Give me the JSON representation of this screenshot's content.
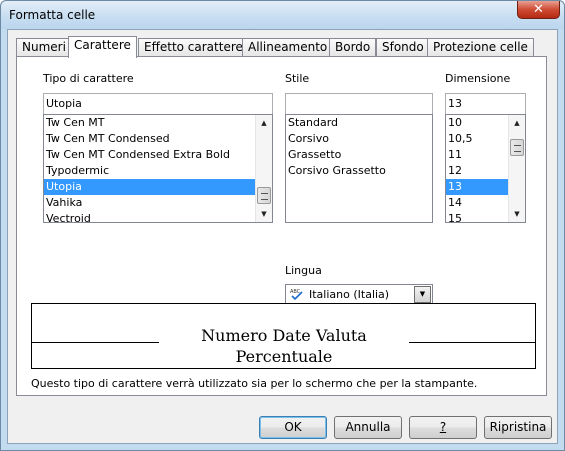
{
  "window": {
    "title": "Formatta celle",
    "close_glyph": "✕"
  },
  "tabs": [
    {
      "label": "Numeri",
      "active": false
    },
    {
      "label": "Carattere",
      "active": true
    },
    {
      "label": "Effetto carattere",
      "active": false
    },
    {
      "label": "Allineamento",
      "active": false
    },
    {
      "label": "Bordo",
      "active": false
    },
    {
      "label": "Sfondo",
      "active": false
    },
    {
      "label": "Protezione celle",
      "active": false
    }
  ],
  "font": {
    "label": "Tipo di carattere",
    "value": "Utopia",
    "items": [
      "Tw Cen MT",
      "Tw Cen MT Condensed",
      "Tw Cen MT Condensed Extra Bold",
      "Typodermic",
      "Utopia",
      "Vahika",
      "Vectroid"
    ],
    "selected": "Utopia"
  },
  "style": {
    "label": "Stile",
    "value": "",
    "items": [
      "Standard",
      "Corsivo",
      "Grassetto",
      "Corsivo Grassetto"
    ]
  },
  "size": {
    "label": "Dimensione",
    "value": "13",
    "items": [
      "10",
      "10,5",
      "11",
      "12",
      "13",
      "14",
      "15"
    ],
    "selected": "13"
  },
  "language": {
    "label": "Lingua",
    "value": "Italiano (Italia)",
    "icon": "spellcheck-icon"
  },
  "preview": {
    "text": "Numero Date Valuta Percentuale"
  },
  "info": {
    "text": "Questo tipo di carattere verrà utilizzato sia per lo schermo che per la stampante."
  },
  "buttons": {
    "ok": "OK",
    "cancel": "Annulla",
    "help": "?",
    "reset": "Ripristina"
  }
}
